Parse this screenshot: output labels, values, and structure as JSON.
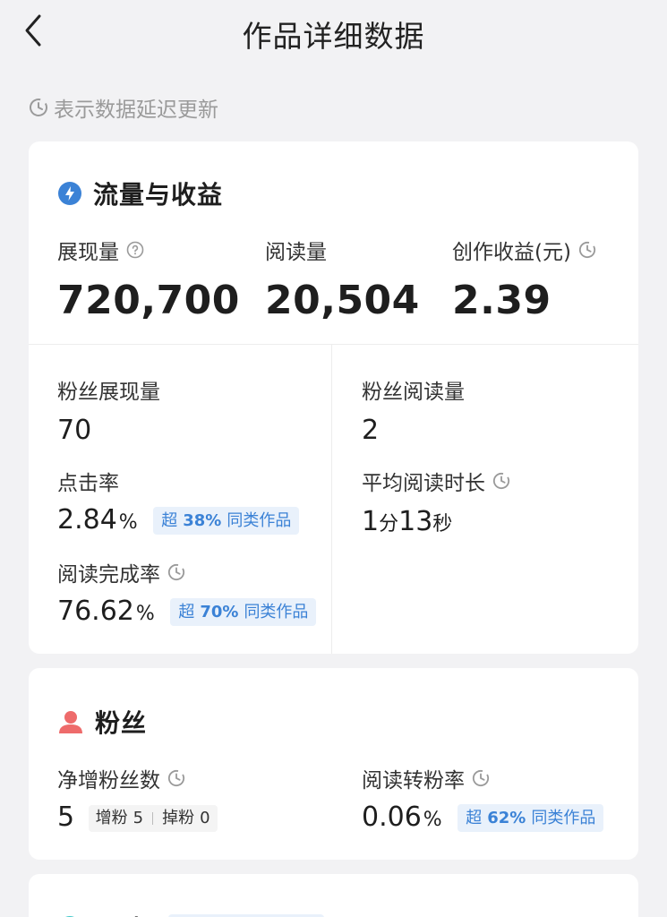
{
  "header": {
    "title": "作品详细数据"
  },
  "note": {
    "text": "表示数据延迟更新"
  },
  "traffic": {
    "title": "流量与收益",
    "impressions": {
      "label": "展现量",
      "value": "720,700"
    },
    "reads": {
      "label": "阅读量",
      "value": "20,504"
    },
    "earnings": {
      "label": "创作收益(元)",
      "value": "2.39"
    },
    "fan_impressions": {
      "label": "粉丝展现量",
      "value": "70"
    },
    "fan_reads": {
      "label": "粉丝阅读量",
      "value": "2"
    },
    "ctr": {
      "label": "点击率",
      "value": "2.84",
      "unit": "%",
      "badge_prefix": "超",
      "badge_value": "38%",
      "badge_suffix": "同类作品"
    },
    "avg_read_time": {
      "label": "平均阅读时长",
      "min_value": "1",
      "min_unit": "分",
      "sec_value": "13",
      "sec_unit": "秒"
    },
    "completion": {
      "label": "阅读完成率",
      "value": "76.62",
      "unit": "%",
      "badge_prefix": "超",
      "badge_value": "70%",
      "badge_suffix": "同类作品"
    }
  },
  "fans": {
    "title": "粉丝",
    "net_gain": {
      "label": "净增粉丝数",
      "value": "5",
      "gain_label": "增粉",
      "gain_value": "5",
      "loss_label": "掉粉",
      "loss_value": "0"
    },
    "conversion": {
      "label": "阅读转粉率",
      "value": "0.06",
      "unit": "%",
      "badge_prefix": "超",
      "badge_value": "62%",
      "badge_suffix": "同类作品"
    }
  },
  "interaction": {
    "title": "互动"
  },
  "colors": {
    "accent_blue": "#3b82d6",
    "badge_bg": "#e9f1fb",
    "fans_red": "#ee6b6b",
    "interaction_teal": "#3fc7c9"
  },
  "icons": [
    "back-arrow-icon",
    "clock-icon",
    "help-circle-icon",
    "flame-drop-icon",
    "person-icon"
  ]
}
